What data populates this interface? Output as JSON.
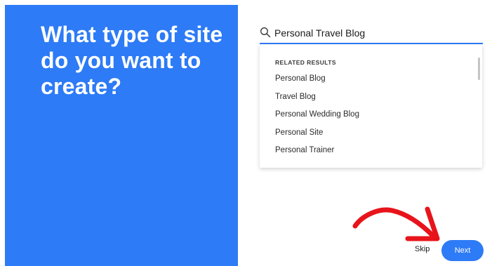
{
  "left_panel": {
    "headline": "What type of site do you want to create?"
  },
  "search": {
    "value": "Personal Travel Blog",
    "icon": "search-icon"
  },
  "dropdown": {
    "header": "RELATED RESULTS",
    "results": [
      "Personal Blog",
      "Travel Blog",
      "Personal Wedding Blog",
      "Personal Site",
      "Personal Trainer"
    ]
  },
  "footer": {
    "skip_label": "Skip",
    "next_label": "Next"
  },
  "colors": {
    "brand_blue": "#2d7bf6",
    "annotation_red": "#e8141b"
  }
}
